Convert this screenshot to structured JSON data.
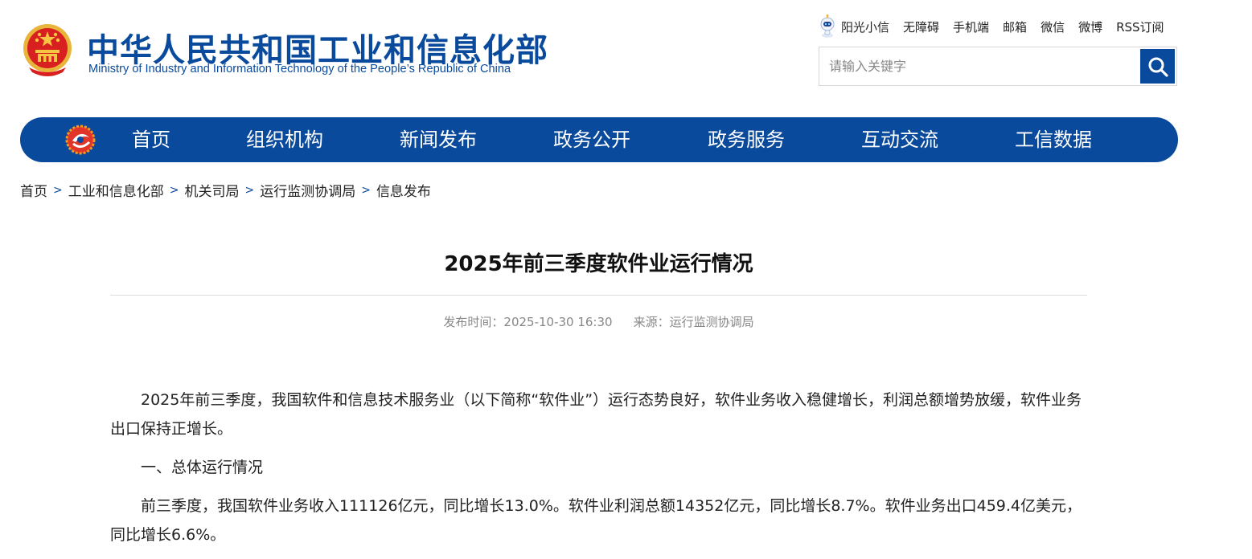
{
  "header": {
    "site_name_cn": "中华人民共和国工业和信息化部",
    "site_name_en": "Ministry of Industry and Information Technology of the People’s Republic of China",
    "top_links": [
      "阳光小信",
      "无障碍",
      "手机端",
      "邮箱",
      "微信",
      "微博",
      "RSS订阅"
    ],
    "search": {
      "placeholder": "请输入关键字"
    }
  },
  "nav": {
    "items": [
      "首页",
      "组织机构",
      "新闻发布",
      "政务公开",
      "政务服务",
      "互动交流",
      "工信数据"
    ]
  },
  "breadcrumb": [
    "首页",
    "工业和信息化部",
    "机关司局",
    "运行监测协调局",
    "信息发布"
  ],
  "breadcrumb_sep": ">",
  "article": {
    "title": "2025年前三季度软件业运行情况",
    "publish_label": "发布时间：",
    "publish_time": "2025-10-30 16:30",
    "source_label": "来源：",
    "source": "运行监测协调局",
    "paragraphs": [
      "2025年前三季度，我国软件和信息技术服务业（以下简称“软件业”）运行态势良好，软件业务收入稳健增长，利润总额增势放缓，软件业务出口保持正增长。",
      "一、总体运行情况",
      "前三季度，我国软件业务收入111126亿元，同比增长13.0%。软件业利润总额14352亿元，同比增长8.7%。软件业务出口459.4亿美元，同比增长6.6%。"
    ]
  },
  "colors": {
    "brand_blue": "#0a4a9c",
    "emblem_red": "#d7201f",
    "emblem_gold": "#f6c542"
  }
}
